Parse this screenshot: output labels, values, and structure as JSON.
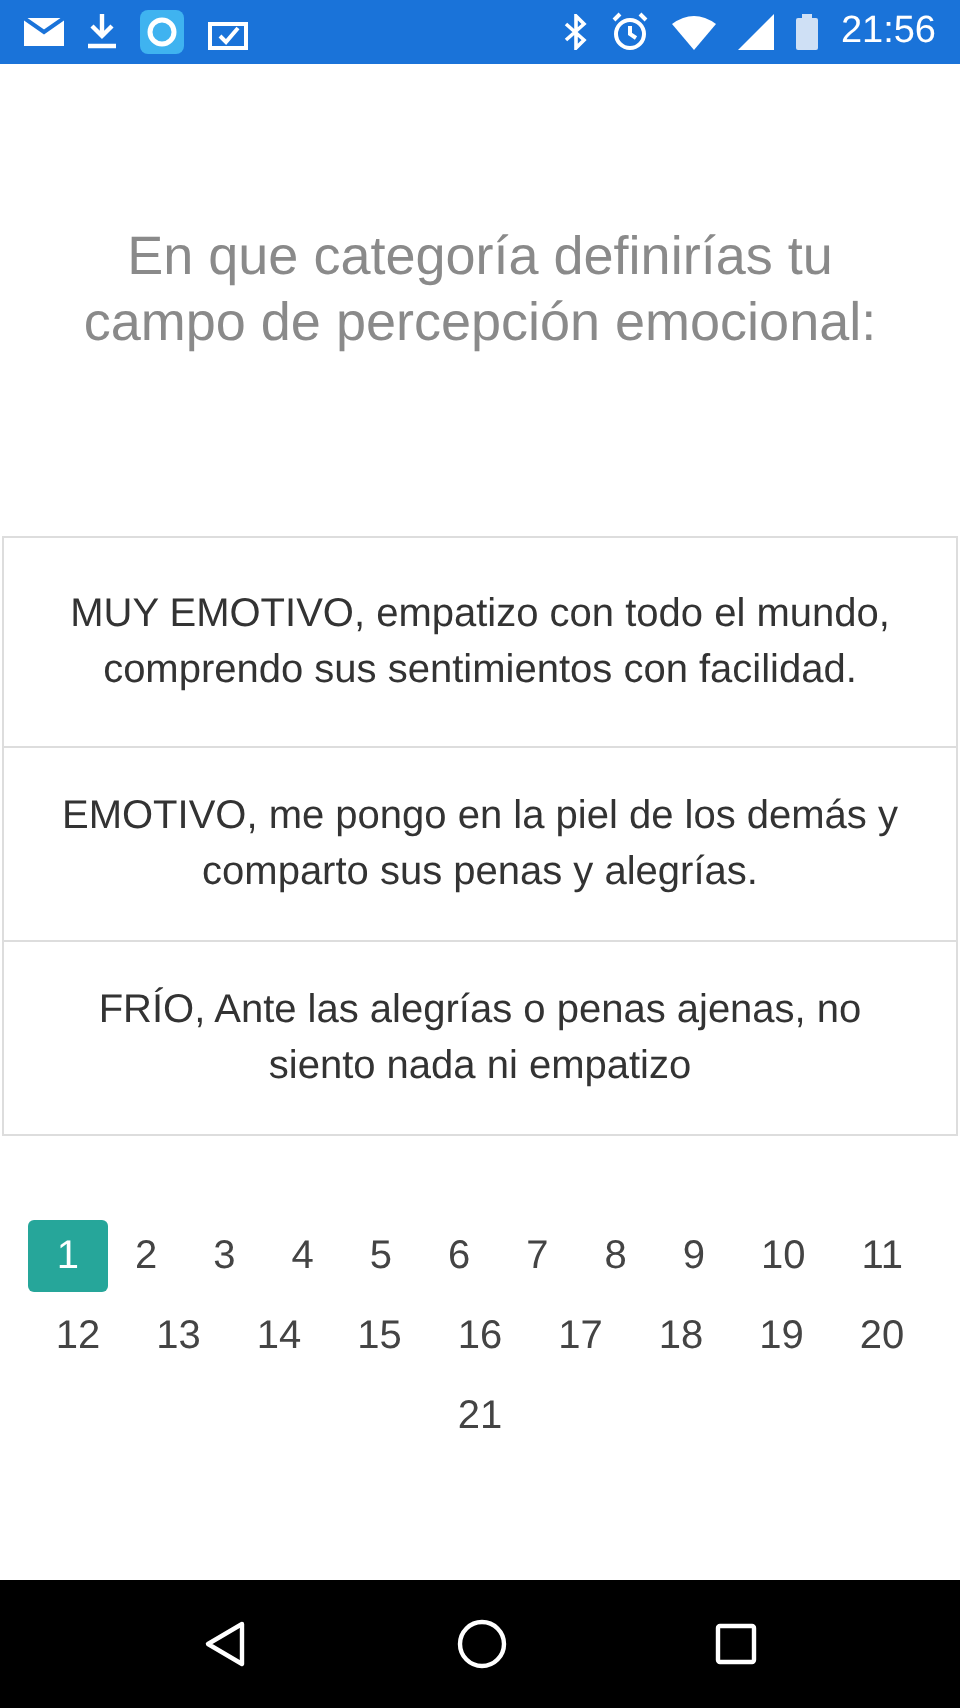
{
  "status_bar": {
    "time": "21:56"
  },
  "question": "En que categoría definirías tu campo de percepción emocional:",
  "options": [
    {
      "text": "MUY EMOTIVO, empatizo con todo el mundo, comprendo sus sentimientos con facilidad."
    },
    {
      "text": "EMOTIVO, me pongo en la piel de los demás y comparto sus penas y alegrías."
    },
    {
      "text": "FRÍO, Ante las alegrías o penas ajenas, no siento nada ni empatizo"
    }
  ],
  "pages": [
    {
      "label": "1",
      "selected": true
    },
    {
      "label": "2",
      "selected": false
    },
    {
      "label": "3",
      "selected": false
    },
    {
      "label": "4",
      "selected": false
    },
    {
      "label": "5",
      "selected": false
    },
    {
      "label": "6",
      "selected": false
    },
    {
      "label": "7",
      "selected": false
    },
    {
      "label": "8",
      "selected": false
    },
    {
      "label": "9",
      "selected": false
    },
    {
      "label": "10",
      "selected": false
    },
    {
      "label": "11",
      "selected": false
    },
    {
      "label": "12",
      "selected": false
    },
    {
      "label": "13",
      "selected": false
    },
    {
      "label": "14",
      "selected": false
    },
    {
      "label": "15",
      "selected": false
    },
    {
      "label": "16",
      "selected": false
    },
    {
      "label": "17",
      "selected": false
    },
    {
      "label": "18",
      "selected": false
    },
    {
      "label": "19",
      "selected": false
    },
    {
      "label": "20",
      "selected": false
    },
    {
      "label": "21",
      "selected": false
    }
  ]
}
